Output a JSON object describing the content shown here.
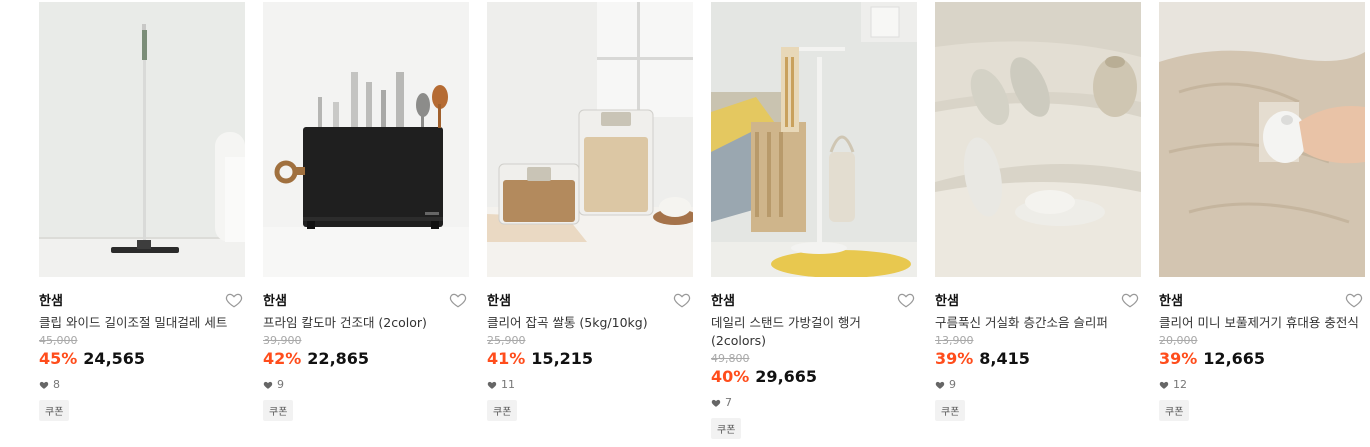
{
  "products": [
    {
      "brand": "한샘",
      "title": "클립 와이드 길이조절 밀대걸레 세트",
      "original_price": "45,000",
      "discount_rate": "45%",
      "sale_price": "24,565",
      "likes": "8",
      "coupon": "쿠폰",
      "image": "mop-photo"
    },
    {
      "brand": "한샘",
      "title": "프라임 칼도마 건조대 (2color)",
      "original_price": "39,900",
      "discount_rate": "42%",
      "sale_price": "22,865",
      "likes": "9",
      "coupon": "쿠폰",
      "image": "knife-stand-photo"
    },
    {
      "brand": "한샘",
      "title": "클리어 잡곡 쌀통 (5kg/10kg)",
      "original_price": "25,900",
      "discount_rate": "41%",
      "sale_price": "15,215",
      "likes": "11",
      "coupon": "쿠폰",
      "image": "rice-container-photo"
    },
    {
      "brand": "한샘",
      "title": "데일리 스탠드 가방걸이 행거 (2colors)",
      "original_price": "49,800",
      "discount_rate": "40%",
      "sale_price": "29,665",
      "likes": "7",
      "coupon": "쿠폰",
      "image": "bag-hanger-photo"
    },
    {
      "brand": "한샘",
      "title": "구름푹신 거실화 층간소음 슬리퍼",
      "original_price": "13,900",
      "discount_rate": "39%",
      "sale_price": "8,415",
      "likes": "9",
      "coupon": "쿠폰",
      "image": "slippers-photo"
    },
    {
      "brand": "한샘",
      "title": "클리어 미니 보풀제거기 휴대용 충전식",
      "original_price": "20,000",
      "discount_rate": "39%",
      "sale_price": "12,665",
      "likes": "12",
      "coupon": "쿠폰",
      "image": "lint-remover-photo"
    }
  ],
  "colors": {
    "discount": "#ff4d1c",
    "coupon_bg": "#f2f2f2"
  }
}
